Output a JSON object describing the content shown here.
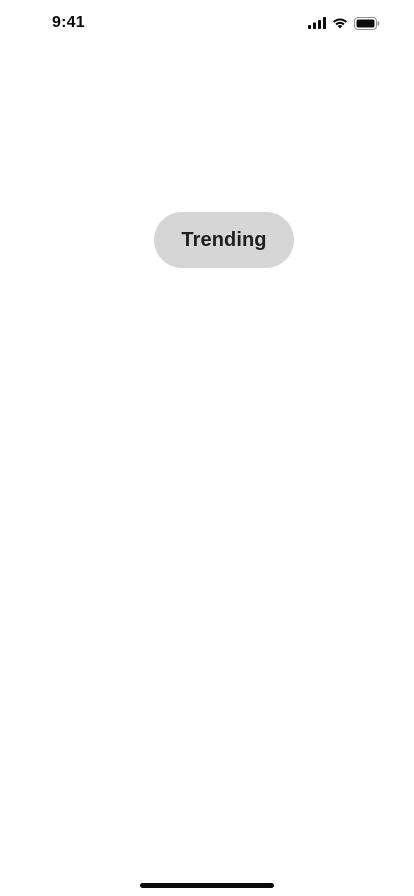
{
  "status_bar": {
    "time": "9:41",
    "icons": [
      "cellular-signal-icon",
      "wifi-icon",
      "battery-icon"
    ]
  },
  "main": {
    "trending_button": {
      "label": "Trending"
    }
  },
  "colors": {
    "pill_background": "#d6d6d6",
    "text": "#1f1f1f",
    "background": "#ffffff"
  }
}
